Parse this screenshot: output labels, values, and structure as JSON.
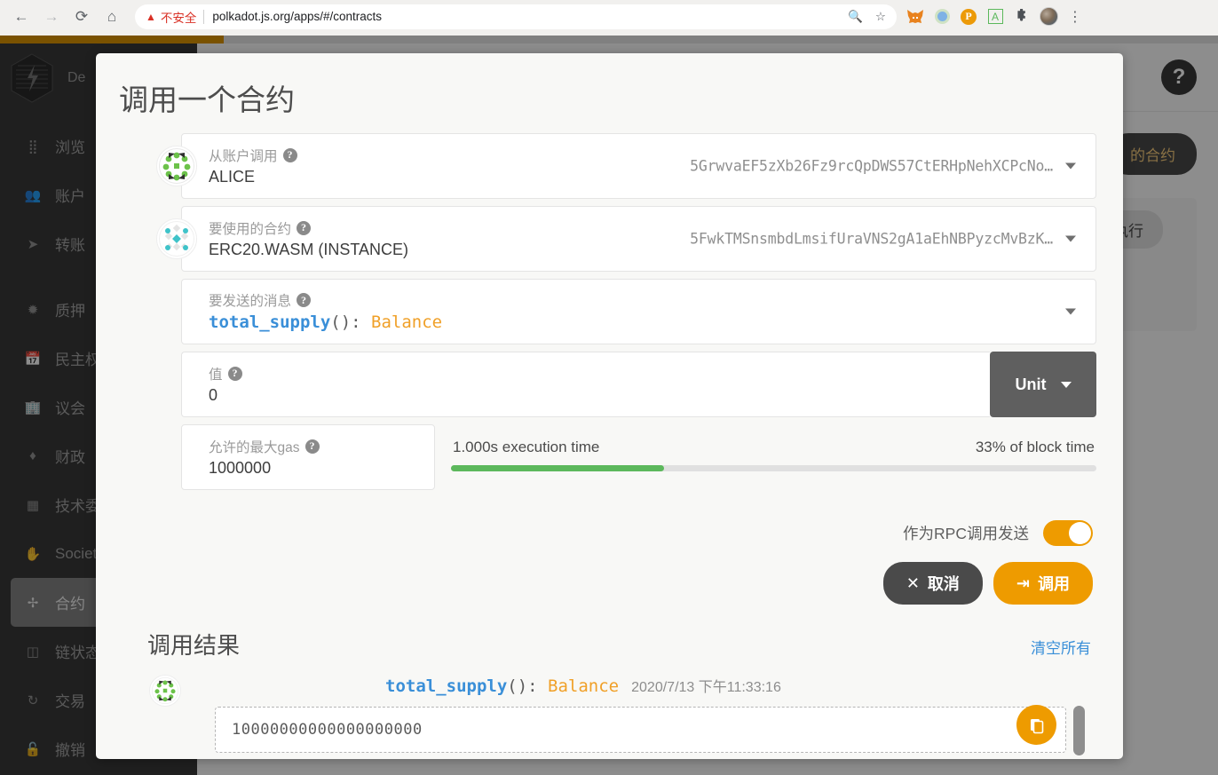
{
  "browser": {
    "back_icon": "arrow-left-icon",
    "forward_icon": "arrow-right-icon",
    "reload_icon": "reload-icon",
    "home_icon": "home-icon",
    "security_warning": "不安全",
    "url": "polkadot.js.org/apps/#/contracts",
    "zoom_icon": "zoom-search-icon",
    "bookmark_icon": "star-icon",
    "extensions": [
      {
        "name": "metamask-extension-icon",
        "glyph": "🦊"
      },
      {
        "name": "circle-extension-icon",
        "glyph": ""
      },
      {
        "name": "polkadot-extension-icon",
        "glyph": "P"
      },
      {
        "name": "adblock-extension-icon",
        "glyph": "A"
      },
      {
        "name": "puzzle-extensions-icon",
        "glyph": "✦"
      },
      {
        "name": "profile-avatar",
        "glyph": ""
      }
    ],
    "menu_icon": "three-dots-menu-icon"
  },
  "sidebar": {
    "brand": "De",
    "items": [
      {
        "label": "浏览",
        "icon": "grid-dots-icon",
        "active": false
      },
      {
        "label": "账户",
        "icon": "users-icon",
        "active": false
      },
      {
        "label": "转账",
        "icon": "paper-plane-icon",
        "active": false
      },
      {
        "label": "质押",
        "icon": "gear-sun-icon",
        "active": false
      },
      {
        "label": "民主权",
        "icon": "calendar-check-icon",
        "active": false
      },
      {
        "label": "议会",
        "icon": "building-icon",
        "active": false
      },
      {
        "label": "财政",
        "icon": "gem-icon",
        "active": false
      },
      {
        "label": "技术委",
        "icon": "memory-chip-icon",
        "active": false
      },
      {
        "label": "Societ",
        "icon": "hand-icon",
        "active": false
      },
      {
        "label": "合约",
        "icon": "arrows-inward-icon",
        "active": true
      },
      {
        "label": "链状态",
        "icon": "database-icon",
        "active": false
      },
      {
        "label": "交易",
        "icon": "refresh-cycle-icon",
        "active": false
      },
      {
        "label": "撤销",
        "icon": "unlock-icon",
        "active": false
      }
    ]
  },
  "background_page": {
    "help_button": "?",
    "contracts_button": "的合约",
    "execute_button": "执行"
  },
  "modal": {
    "title": "调用一个合约",
    "fields": {
      "from_account": {
        "label": "从账户调用",
        "value": "ALICE",
        "address": "5GrwvaEF5zXb26Fz9rcQpDWS57CtERHpNehXCPcNo…",
        "identicon": "alice-identicon"
      },
      "contract": {
        "label": "要使用的合约",
        "value": "ERC20.WASM (INSTANCE)",
        "address": "5FwkTMSnsmbdLmsifUraVNS2gA1aEhNBPyzcMvBzK…",
        "identicon": "contract-identicon"
      },
      "message": {
        "label": "要发送的消息",
        "fn_name": "total_supply",
        "fn_parens": "(): ",
        "fn_type": "Balance"
      },
      "value": {
        "label": "值",
        "value": "0",
        "unit": "Unit"
      },
      "gas": {
        "label": "允许的最大gas",
        "value": "1000000",
        "execution_time": "1.000s execution time",
        "block_time": "33% of block time",
        "fill_percent": 33
      }
    },
    "rpc_toggle": {
      "label": "作为RPC调用发送",
      "on": true
    },
    "buttons": {
      "cancel": "取消",
      "cancel_icon": "close-x-icon",
      "call": "调用",
      "call_icon": "sign-in-arrow-icon"
    },
    "results": {
      "title": "调用结果",
      "clear_all": "清空所有",
      "rows": [
        {
          "identicon": "result-identicon",
          "fn_name": "total_supply",
          "fn_parens": "(): ",
          "fn_type": "Balance",
          "timestamp": "2020/7/13 下午11:33:16",
          "output": "10000000000000000000",
          "copy_icon": "copy-icon"
        }
      ]
    }
  },
  "colors": {
    "accent_orange": "#ee9b00",
    "link_blue": "#3a8fd8",
    "type_orange": "#f0a028",
    "meter_green": "#5cb85c",
    "sidebar_bg": "#2b2b2b",
    "modal_bg": "#f8f8f6",
    "warning_red": "#d93025"
  }
}
